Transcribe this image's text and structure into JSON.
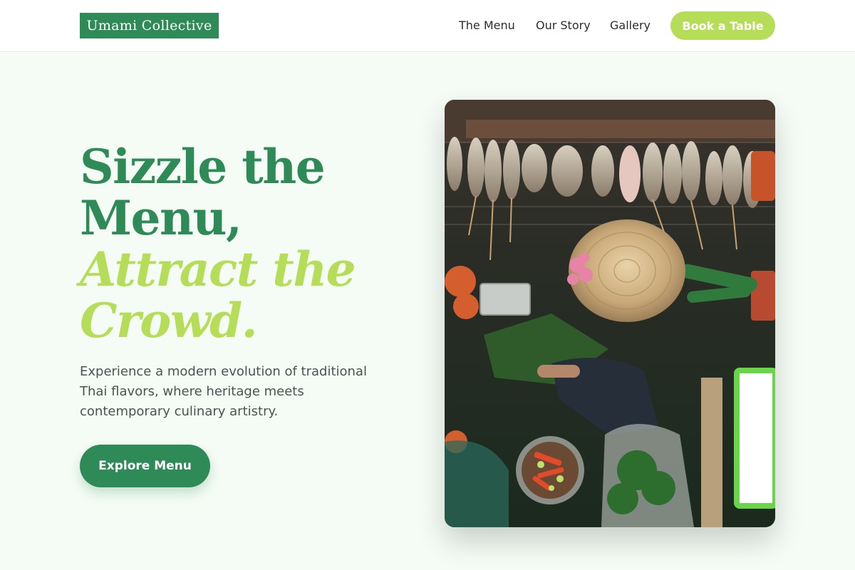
{
  "brand": {
    "name": "Umami Collective"
  },
  "nav": {
    "links": [
      "The Menu",
      "Our Story",
      "Gallery"
    ],
    "cta": "Book a Table"
  },
  "hero": {
    "title_lines": [
      "Sizzle the",
      "Menu,",
      "Attract the",
      "Crowd."
    ],
    "description": "Experience a modern evolution of traditional Thai flavors, where heritage meets contemporary culinary artistry.",
    "button": "Explore Menu"
  },
  "image": {
    "icon": "thai-street-food-photo"
  },
  "colors": {
    "primary": "#2e8b57",
    "accent": "#b5dd58",
    "background": "#f5fcf5",
    "text": "#4a5452"
  }
}
